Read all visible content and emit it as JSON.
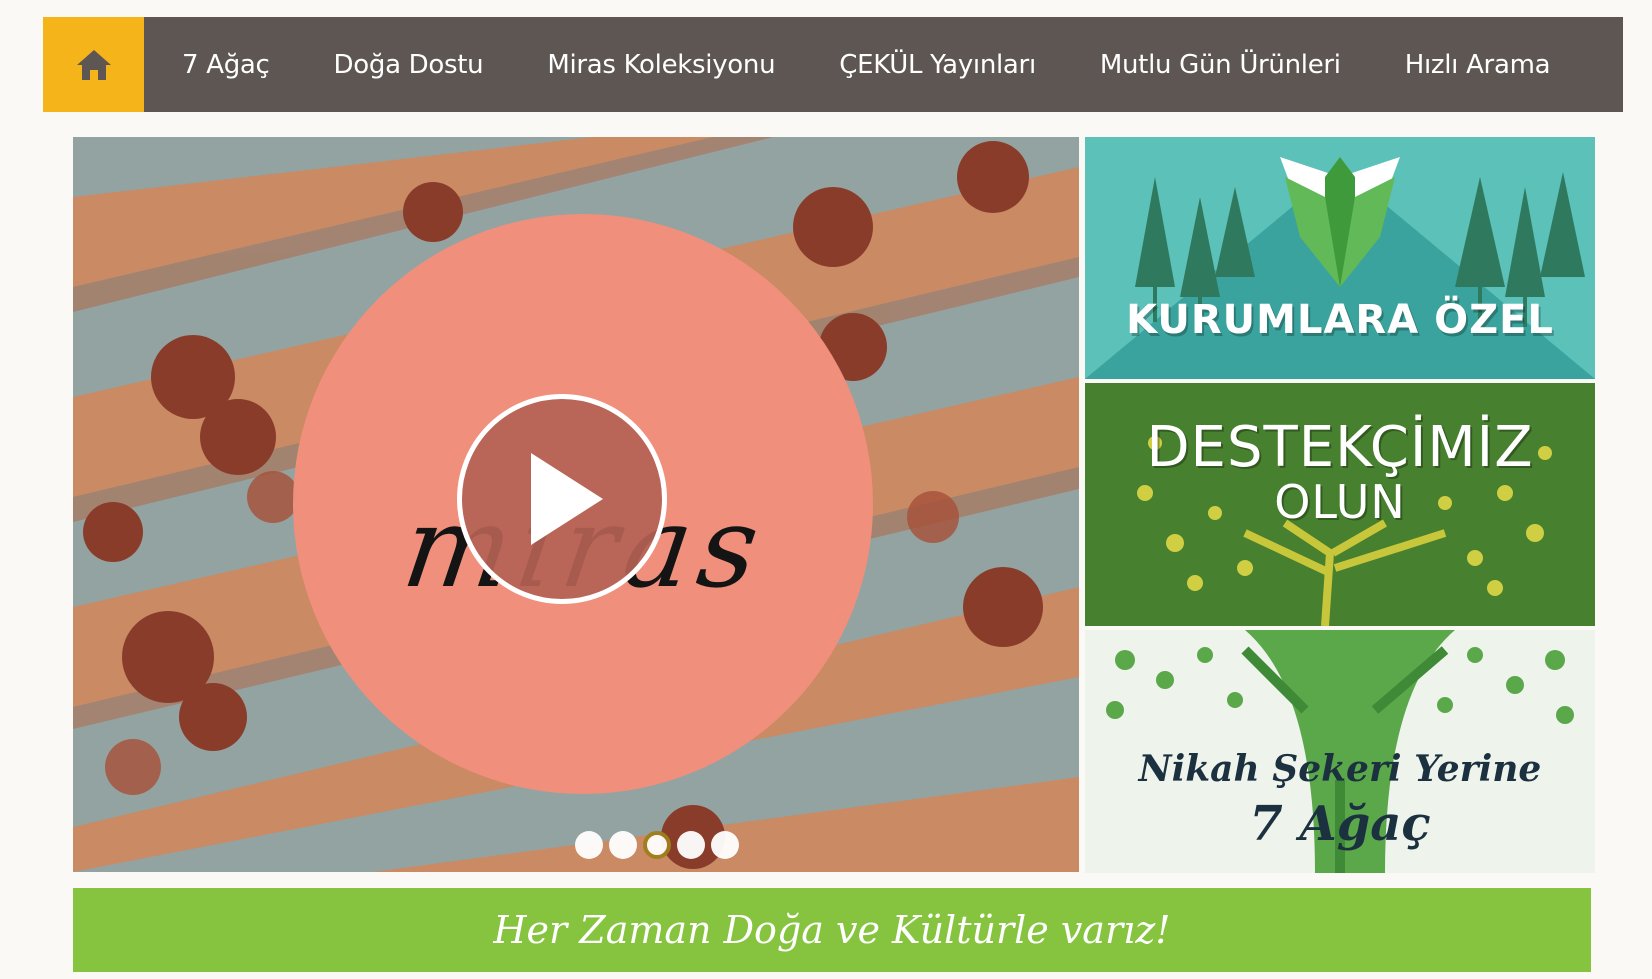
{
  "nav": {
    "home_icon": "home-icon",
    "items": [
      "7 Ağaç",
      "Doğa Dostu",
      "Miras Koleksiyonu",
      "ÇEKÜL Yayınları",
      "Mutlu Gün Ürünleri",
      "Hızlı Arama"
    ]
  },
  "hero": {
    "wordmark": "miras",
    "play_icon": "play-icon",
    "slides": 5,
    "active_slide": 3
  },
  "banners": {
    "corporate": "KURUMLARA ÖZEL",
    "support_line1": "DESTEKÇİMİZ",
    "support_line2": "OLUN",
    "wedding_line1": "Nikah Şekeri Yerine",
    "wedding_line2": "7 Ağaç"
  },
  "slogan": "Her Zaman Doğa ve Kültürle varız!",
  "colors": {
    "nav_bg": "#5e5652",
    "home_bg": "#f4b41a",
    "slogan_bg": "#86c440",
    "hero_circle": "#f08f7c"
  }
}
